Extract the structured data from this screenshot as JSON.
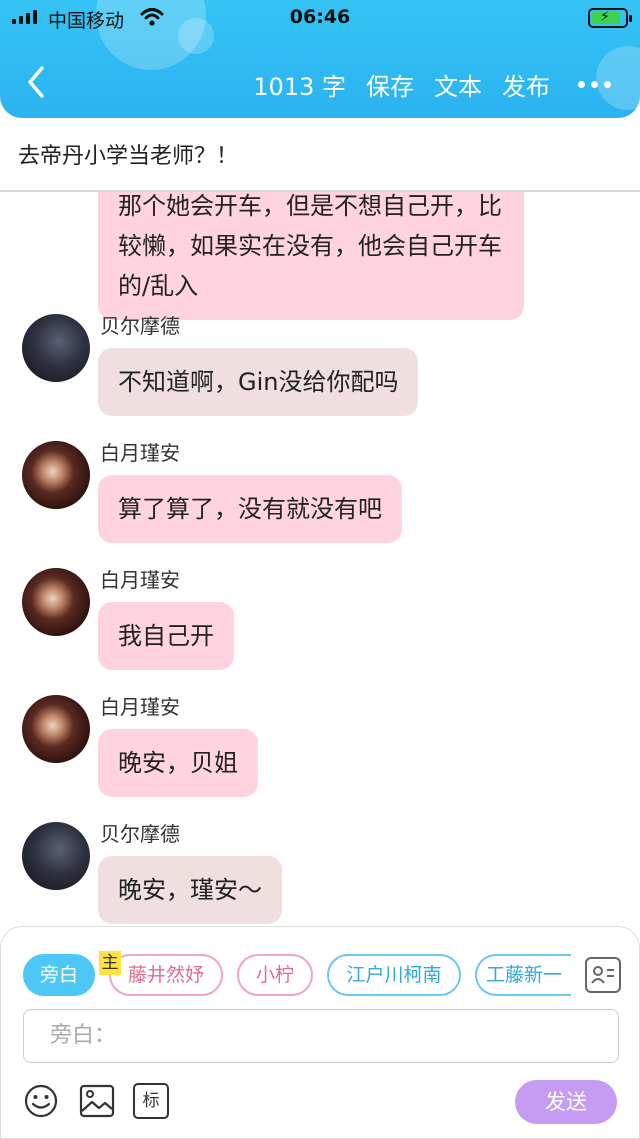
{
  "status_bar": {
    "carrier": "中国移动",
    "time": "06:46",
    "battery_charging": true
  },
  "header": {
    "word_count": "1013 字",
    "save_label": "保存",
    "text_label": "文本",
    "publish_label": "发布"
  },
  "title": "去帝丹小学当老师？！",
  "messages": [
    {
      "author": "",
      "text": "那个她会开车，但是不想自己开，比较懒，如果实在没有，他会自己开车的/乱入",
      "style": "pink"
    },
    {
      "author": "贝尔摩德",
      "text": "不知道啊，Gin没给你配吗",
      "style": "grey"
    },
    {
      "author": "白月瑾安",
      "text": "算了算了，没有就没有吧",
      "style": "pink"
    },
    {
      "author": "白月瑾安",
      "text": "我自己开",
      "style": "pink"
    },
    {
      "author": "白月瑾安",
      "text": "晚安，贝姐",
      "style": "pink"
    },
    {
      "author": "贝尔摩德",
      "text": "晚安，瑾安～",
      "style": "grey"
    }
  ],
  "roles": [
    {
      "label": "旁白",
      "active": true
    },
    {
      "label": "藤井然妤",
      "owner": true
    },
    {
      "label": "小柠"
    },
    {
      "label": "江户川柯南"
    },
    {
      "label": "工藤新一"
    }
  ],
  "owner_tag": "主",
  "input": {
    "placeholder": "旁白："
  },
  "toolbar": {
    "tag_label": "标",
    "send_label": "发送"
  },
  "colors": {
    "header": "#35c4f5",
    "pink_bubble": "#ffd4de",
    "grey_bubble": "#efdfdf",
    "send_button": "#c59cf1",
    "active_chip": "#4cc7f6"
  }
}
